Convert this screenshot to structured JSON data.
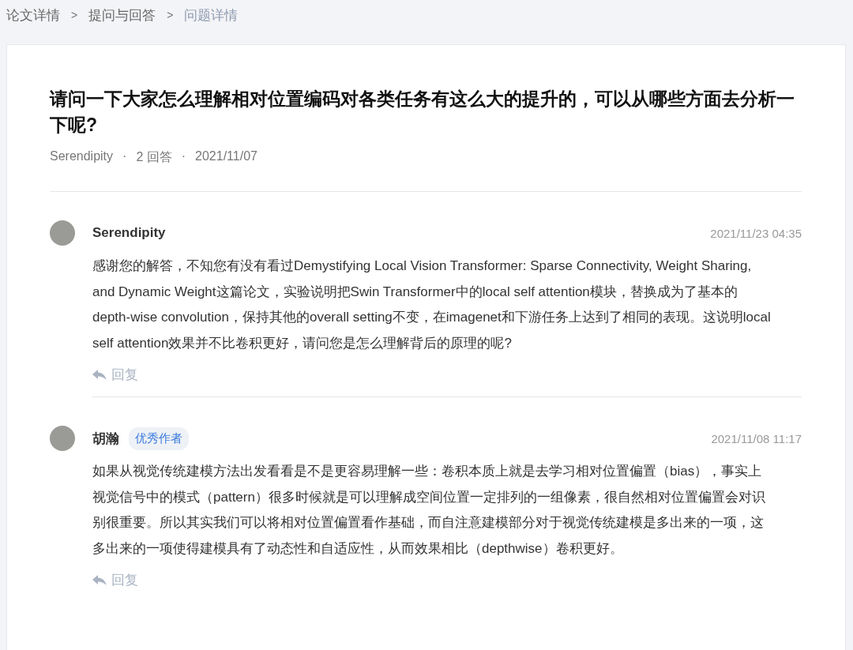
{
  "breadcrumb": [
    {
      "label": "论文详情",
      "selected": false
    },
    {
      "label": "提问与回答",
      "selected": false
    },
    {
      "label": "问题详情",
      "selected": true
    }
  ],
  "breadcrumb_separator": ">",
  "question": {
    "title": "请问一下大家怎么理解相对位置编码对各类任务有这么大的提升的，可以从哪些方面去分析一下呢?",
    "author": "Serendipity",
    "answer_count": "2 回答",
    "date": "2021/11/07",
    "separator": "·"
  },
  "answers": [
    {
      "author": "Serendipity",
      "date": "2021/11/23 04:35",
      "text": "感谢您的解答，不知您有没有看过Demystifying Local Vision Transformer: Sparse Connectivity, Weight Sharing, and Dynamic Weight这篇论文，实验说明把Swin Transformer中的local self attention模块，替换成为了基本的depth-wise convolution，保持其他的overall setting不变，在imagenet和下游任务上达到了相同的表现。这说明local self attention效果并不比卷积更好，请问您是怎么理解背后的原理的呢?",
      "reply": "回复"
    },
    {
      "author": "胡瀚",
      "badge": "优秀作者",
      "date": "2021/11/08 11:17",
      "text": "如果从视觉传统建模方法出发看看是不是更容易理解一些：卷积本质上就是去学习相对位置偏置（bias），事实上视觉信号中的模式（pattern）很多时候就是可以理解成空间位置一定排列的一组像素，很自然相对位置偏置会对识别很重要。所以其实我们可以将相对位置偏置看作基础，而自注意建模部分对于视觉传统建模是多出来的一项，这多出来的一项使得建模具有了动态性和自适应性，从而效果相比（depthwise）卷积更好。",
      "reply": "回复"
    }
  ]
}
